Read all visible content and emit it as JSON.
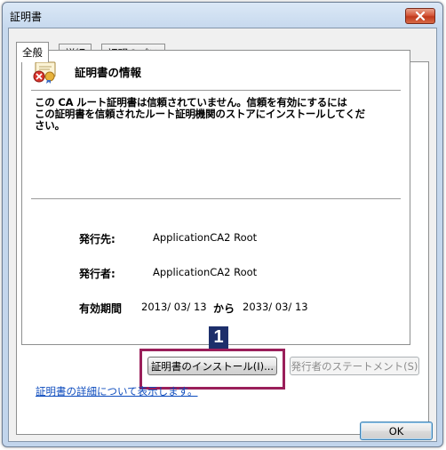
{
  "window": {
    "title": "証明書",
    "close_label": "×"
  },
  "tabs": [
    {
      "label": "全般",
      "active": true
    },
    {
      "label": "詳細",
      "active": false
    },
    {
      "label": "証明のパス",
      "active": false
    }
  ],
  "info": {
    "title": "証明書の情報",
    "warning_line1": "この CA ルート証明書は信頼されていません。信頼を有効にするには",
    "warning_line2": "この証明書を信頼されたルート証明機関のストアにインストールしてくだ",
    "warning_line3": "さい。",
    "issued_to_label": "発行先:",
    "issued_to_value": "ApplicationCA2 Root",
    "issued_by_label": "発行者:",
    "issued_by_value": "ApplicationCA2 Root",
    "validity_label": "有効期間",
    "valid_from": "2013/ 03/ 13",
    "from_word": "から",
    "valid_to": "2033/ 03/ 13"
  },
  "buttons": {
    "install": "証明書のインストール(I)...",
    "issuer_statement": "発行者のステートメント(S)",
    "ok": "OK"
  },
  "details_link": "証明書の詳細について表示します。",
  "annotation": {
    "step": "1",
    "color": "#9a1f5a",
    "badge_color": "#1d2f6b"
  },
  "icons": {
    "certificate": "certificate-error-icon",
    "close": "close-icon"
  }
}
